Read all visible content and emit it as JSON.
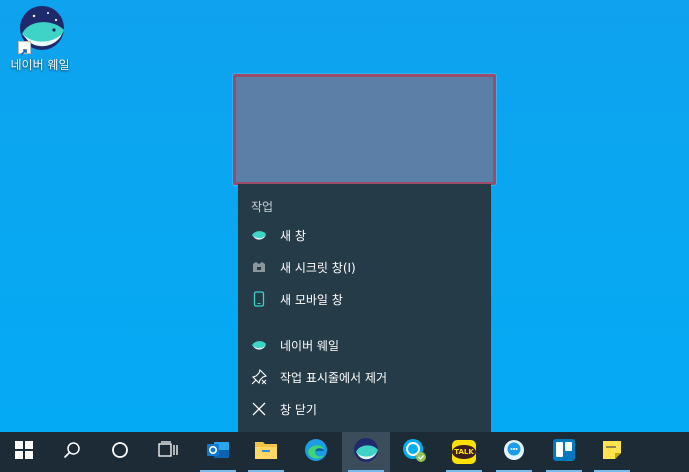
{
  "desktop": {
    "icon_label": "네이버 웨일"
  },
  "jumplist": {
    "section_title": "작업",
    "items": [
      {
        "label": "새 창",
        "icon": "whale-icon"
      },
      {
        "label": "새 시크릿 창(I)",
        "icon": "secret-icon"
      },
      {
        "label": "새 모바일 창",
        "icon": "mobile-icon"
      },
      {
        "label": "네이버 웨일",
        "icon": "whale-icon"
      },
      {
        "label": "작업 표시줄에서 제거",
        "icon": "unpin-icon"
      },
      {
        "label": "창 닫기",
        "icon": "close-icon"
      }
    ]
  },
  "taskbar": {
    "items": [
      {
        "name": "start",
        "icon": "windows-logo-icon"
      },
      {
        "name": "search",
        "icon": "search-icon"
      },
      {
        "name": "cortana",
        "icon": "cortana-circle-icon"
      },
      {
        "name": "task-view",
        "icon": "task-view-icon"
      },
      {
        "name": "outlook",
        "icon": "outlook-icon"
      },
      {
        "name": "file-explorer",
        "icon": "folder-icon"
      },
      {
        "name": "edge",
        "icon": "edge-icon"
      },
      {
        "name": "whale",
        "icon": "whale-icon"
      },
      {
        "name": "skype",
        "icon": "skype-icon"
      },
      {
        "name": "kakaotalk",
        "icon": "kakaotalk-icon"
      },
      {
        "name": "messenger",
        "icon": "chat-bubble-icon"
      },
      {
        "name": "trello",
        "icon": "trello-icon"
      },
      {
        "name": "sticky-notes",
        "icon": "sticky-notes-icon"
      }
    ],
    "kakaotalk_text": "TALK"
  },
  "colors": {
    "desktop_bg": "#08a8f2",
    "jumplist_bg": "#253b48",
    "taskbar_bg": "#1c2b36",
    "preview_bg": "#5b7fa6",
    "preview_border": "#9b4c6a"
  }
}
